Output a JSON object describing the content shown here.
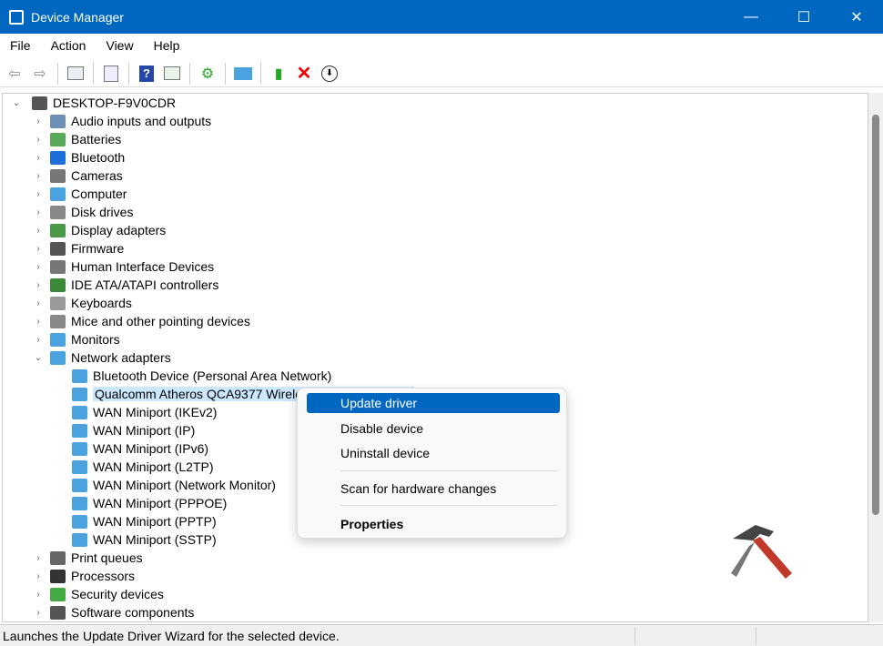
{
  "window": {
    "title": "Device Manager",
    "minimize": "—",
    "maximize": "☐",
    "close": "✕"
  },
  "menu": [
    "File",
    "Action",
    "View",
    "Help"
  ],
  "toolbar": [
    "back-icon",
    "forward-icon",
    "show-hide-tree-icon",
    "properties-icon",
    "help-icon",
    "action-pane-icon",
    "update-driver-icon",
    "scan-hardware-icon",
    "enable-device-icon",
    "uninstall-icon",
    "download-icon"
  ],
  "tree": {
    "root": "DESKTOP-F9V0CDR",
    "categories_before": [
      "Audio inputs and outputs",
      "Batteries",
      "Bluetooth",
      "Cameras",
      "Computer",
      "Disk drives",
      "Display adapters",
      "Firmware",
      "Human Interface Devices",
      "IDE ATA/ATAPI controllers",
      "Keyboards",
      "Mice and other pointing devices",
      "Monitors"
    ],
    "expanded": "Network adapters",
    "network_children": [
      "Bluetooth Device (Personal Area Network)",
      "Qualcomm Atheros QCA9377 Wireless Network Adapter",
      "WAN Miniport (IKEv2)",
      "WAN Miniport (IP)",
      "WAN Miniport (IPv6)",
      "WAN Miniport (L2TP)",
      "WAN Miniport (Network Monitor)",
      "WAN Miniport (PPPOE)",
      "WAN Miniport (PPTP)",
      "WAN Miniport (SSTP)"
    ],
    "selected_index": 1,
    "categories_after": [
      "Print queues",
      "Processors",
      "Security devices",
      "Software components"
    ]
  },
  "context_menu": {
    "update": "Update driver",
    "disable": "Disable device",
    "uninstall": "Uninstall device",
    "scan": "Scan for hardware changes",
    "properties": "Properties"
  },
  "status": "Launches the Update Driver Wizard for the selected device.",
  "colors": {
    "accent": "#0067c0",
    "selection": "#cce8ff"
  }
}
